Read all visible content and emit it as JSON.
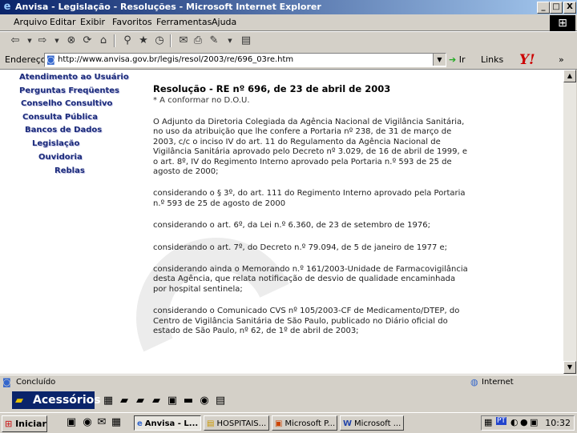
{
  "window": {
    "title": "Anvisa - Legislação - Resoluções - Microsoft Internet Explorer",
    "buttons": {
      "minimize": "_",
      "maximize": "□",
      "close": "X"
    }
  },
  "menu": [
    "Arquivo",
    "Editar",
    "Exibir",
    "Favoritos",
    "Ferramentas",
    "Ajuda"
  ],
  "address_bar": {
    "label": "Endereço",
    "url": "http://www.anvisa.gov.br/legis/resol/2003/re/696_03re.htm",
    "go_label": "Ir",
    "links_label": "Links",
    "more": "»"
  },
  "sidebar_nav": [
    "Atendimento ao Usuário",
    "Perguntas Freqüentes",
    "Conselho Consultivo",
    "Consulta Pública",
    "Bancos de Dados",
    "Legislação",
    "Ouvidoria",
    "Reblas"
  ],
  "document": {
    "title": "Resolução - RE nº 696, de 23 de abril de 2003",
    "subtitle": "* A conformar no D.O.U.",
    "paragraphs": [
      "O Adjunto da Diretoria Colegiada da Agência Nacional de Vigilância Sanitária, no uso da atribuição que lhe confere a Portaria nº 238, de 31 de março de 2003, c/c o inciso IV do art. 11 do Regulamento da Agência Nacional de Vigilância Sanitária aprovado pelo Decreto nº 3.029, de 16 de abril de 1999, e o art. 8º, IV do Regimento Interno aprovado pela Portaria n.º 593 de 25 de agosto de 2000;",
      "considerando o § 3º, do art. 111 do Regimento Interno aprovado pela Portaria n.º 593 de 25 de agosto de 2000",
      "considerando o art. 6º, da Lei n.º 6.360, de 23 de setembro de 1976;",
      "considerando o art. 7º, do Decreto n.º 79.094, de 5 de janeiro de 1977 e;",
      "considerando ainda o Memorando n.º 161/2003-Unidade de Farmacovigilância desta Agência, que relata notificação de desvio de qualidade encaminhada por hospital sentinela;",
      "considerando o Comunicado CVS nº 105/2003-CF de Medicamento/DTEP, do Centro de Vigilância Sanitária de São Paulo, publicado no Diário oficial do estado de São Paulo, nº 62, de 1º de abril de 2003;"
    ]
  },
  "status_bar": {
    "text": "Concluído",
    "zone": "Internet"
  },
  "quick_launch": {
    "label": "Acessórios"
  },
  "taskbar": {
    "start": "Iniciar",
    "tasks": [
      "Anvisa - L...",
      "HOSPITAIS...",
      "Microsoft P...",
      "Microsoft ..."
    ],
    "language": "PT",
    "clock": "10:32"
  }
}
